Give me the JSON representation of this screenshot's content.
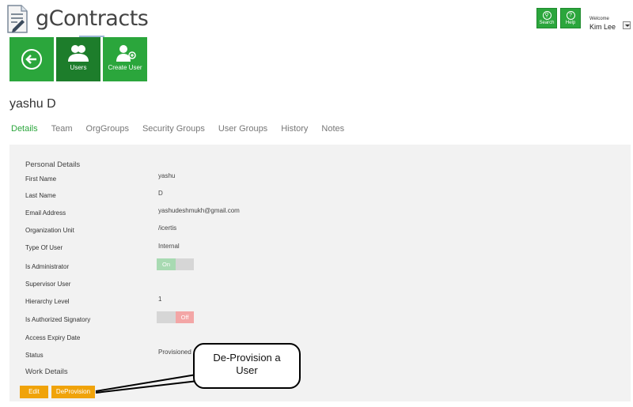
{
  "app": {
    "title": "gContracts"
  },
  "header": {
    "search_label": "Search",
    "help_label": "Help",
    "welcome": "Welcome",
    "user_name": "Kim Lee"
  },
  "tiles": {
    "back_icon": "back-arrow-icon",
    "users_label": "Users",
    "create_user_label": "Create User"
  },
  "page": {
    "title": "yashu D",
    "tabs": [
      "Details",
      "Team",
      "OrgGroups",
      "Security Groups",
      "User Groups",
      "History",
      "Notes"
    ]
  },
  "details": {
    "section_personal": "Personal Details",
    "fields": [
      {
        "label": "First Name",
        "value": "yashu"
      },
      {
        "label": "Last Name",
        "value": "D"
      },
      {
        "label": "Email Address",
        "value": "yashudeshmukh@gmail.com"
      },
      {
        "label": "Organization Unit",
        "value": "/icertis"
      },
      {
        "label": "Type Of User",
        "value": "Internal"
      },
      {
        "label": "Is Administrator",
        "value": "On"
      },
      {
        "label": "Supervisor User",
        "value": ""
      },
      {
        "label": "Hierarchy Level",
        "value": "1"
      },
      {
        "label": "Is Authorized Signatory",
        "value": "Off"
      },
      {
        "label": "Access Expiry Date",
        "value": ""
      },
      {
        "label": "Status",
        "value": "Provisioned"
      }
    ],
    "section_work": "Work Details"
  },
  "actions": {
    "edit_label": "Edit",
    "deprovision_label": "DeProvision"
  },
  "callout": {
    "line1": "De-Provision a",
    "line2": "User"
  },
  "colors": {
    "brand_green": "#2ba63c",
    "dark_green": "#1d7d2b",
    "orange": "#f0a30a"
  }
}
